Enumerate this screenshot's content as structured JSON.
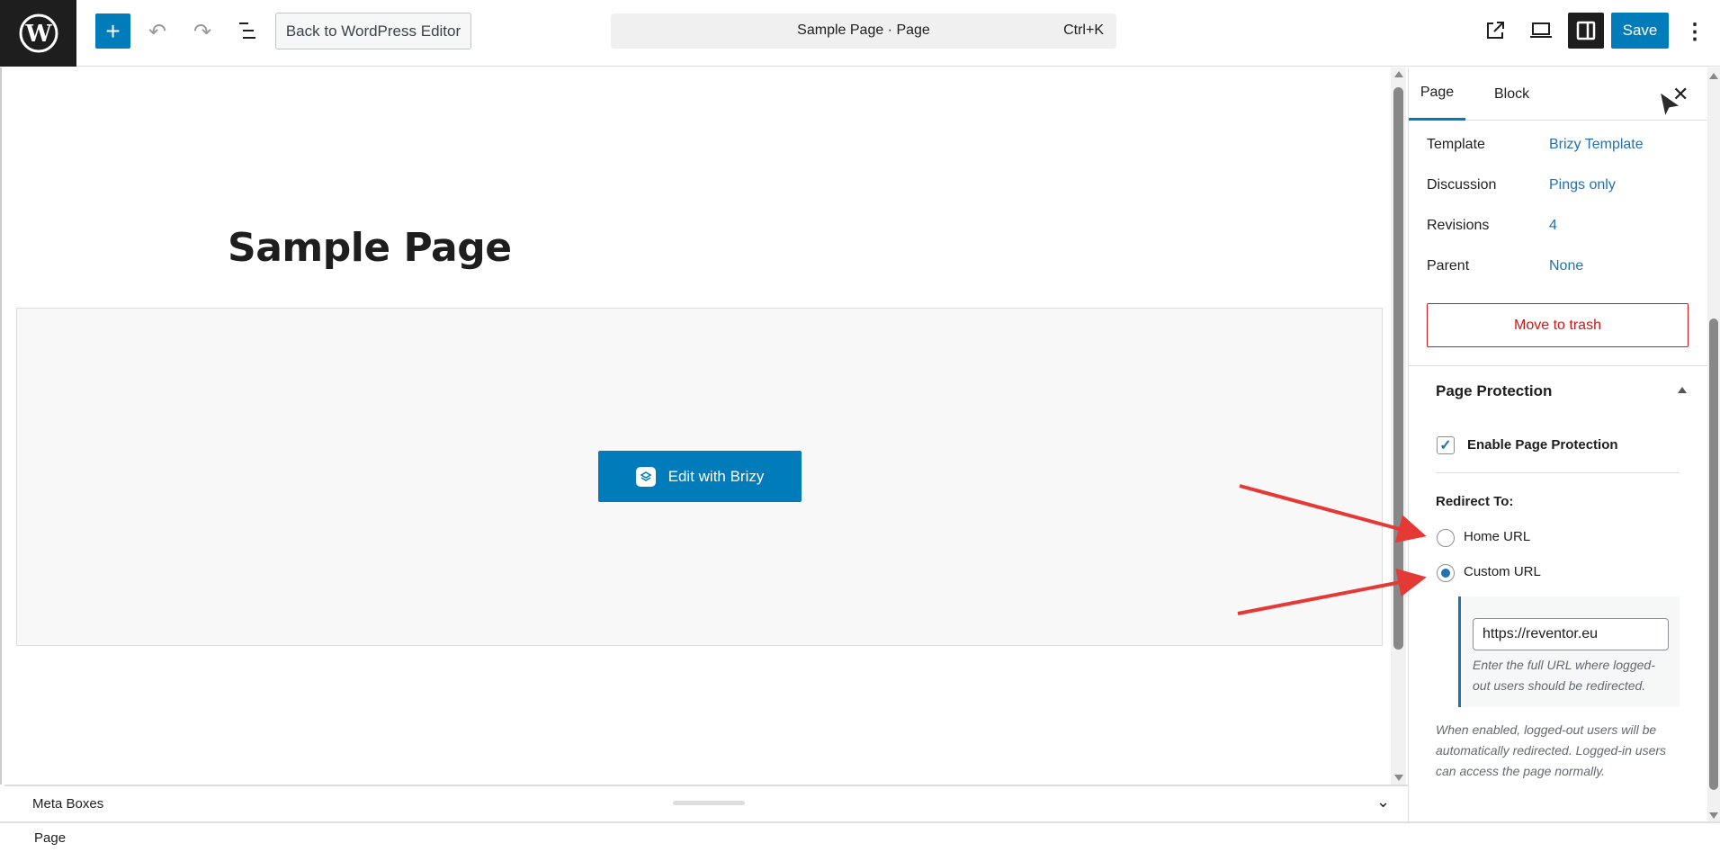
{
  "topbar": {
    "back_label": "Back to WordPress Editor",
    "command_title": "Sample Page · Page",
    "command_shortcut": "Ctrl+K",
    "save_label": "Save"
  },
  "canvas": {
    "page_title": "Sample Page",
    "edit_button_label": "Edit with Brizy"
  },
  "meta_boxes": {
    "label": "Meta Boxes"
  },
  "footer": {
    "breadcrumb": "Page"
  },
  "sidebar": {
    "tabs": [
      {
        "label": "Page",
        "active": true
      },
      {
        "label": "Block",
        "active": false
      }
    ],
    "rows": [
      {
        "label": "Template",
        "value": "Brizy Template"
      },
      {
        "label": "Discussion",
        "value": "Pings only"
      },
      {
        "label": "Revisions",
        "value": "4"
      },
      {
        "label": "Parent",
        "value": "None"
      }
    ],
    "trash_label": "Move to trash",
    "protection": {
      "title": "Page Protection",
      "enable_label": "Enable Page Protection",
      "enabled": true,
      "redirect_label": "Redirect To:",
      "options": [
        {
          "label": "Home URL",
          "selected": false
        },
        {
          "label": "Custom URL",
          "selected": true
        }
      ],
      "custom_url_value": "https://reventor.eu",
      "custom_url_help": "Enter the full URL where logged-out users should be redirected.",
      "description": "When enabled, logged-out users will be automatically redirected. Logged-in users can access the page normally."
    }
  },
  "colors": {
    "accent": "#007cba",
    "danger": "#cc1818",
    "annotation_arrow": "#e53935"
  }
}
